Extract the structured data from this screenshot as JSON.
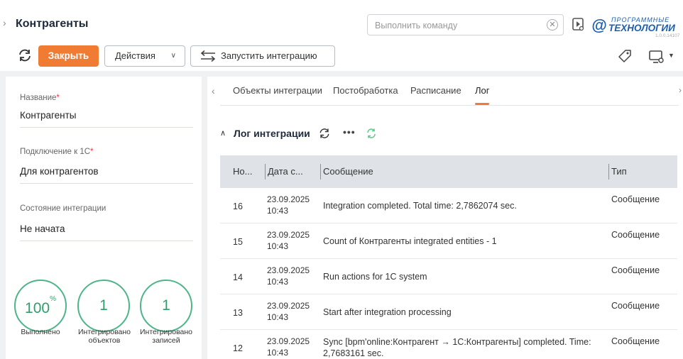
{
  "header": {
    "title": "Контрагенты",
    "command_placeholder": "Выполнить команду",
    "logo_top": "ПРОГРАММНЫЕ",
    "logo_main": "ТЕХНОЛОГИИ",
    "logo_version": "1.0.0.14107"
  },
  "toolbar": {
    "close_label": "Закрыть",
    "actions_label": "Действия",
    "run_integration_label": "Запустить интеграцию"
  },
  "form": {
    "name_label": "Название",
    "name_value": "Контрагенты",
    "connection_label": "Подключение к 1С",
    "connection_value": "Для контрагентов",
    "state_label": "Состояние интеграции",
    "state_value": "Не начата",
    "required_mark": "*"
  },
  "stats": [
    {
      "value": "100",
      "suffix": "%",
      "caption": "Выполнено"
    },
    {
      "value": "1",
      "suffix": "",
      "caption": "Интегрировано объектов"
    },
    {
      "value": "1",
      "suffix": "",
      "caption": "Интегрировано записей"
    }
  ],
  "tabs": [
    {
      "label": "Объекты интеграции",
      "active": false
    },
    {
      "label": "Постобработка",
      "active": false
    },
    {
      "label": "Расписание",
      "active": false
    },
    {
      "label": "Лог",
      "active": true
    }
  ],
  "log": {
    "title": "Лог интеграции",
    "columns": [
      "Но...",
      "Дата с...",
      "Сообщение",
      "Тип"
    ],
    "rows": [
      {
        "no": "16",
        "date": "23.09.2025 10:43",
        "message": "Integration completed. Total time: 2,7862074 sec.",
        "type": "Сообщение"
      },
      {
        "no": "15",
        "date": "23.09.2025 10:43",
        "message": "Count of Контрагенты integrated entities - 1",
        "type": "Сообщение"
      },
      {
        "no": "14",
        "date": "23.09.2025 10:43",
        "message": "Run actions for 1C system",
        "type": "Сообщение"
      },
      {
        "no": "13",
        "date": "23.09.2025 10:43",
        "message": "Start after integration processing",
        "type": "Сообщение"
      },
      {
        "no": "12",
        "date": "23.09.2025 10:43",
        "message": "Sync [bpm'online:Контрагент → 1C:Контрагенты] completed. Time: 2,7683161 sec.",
        "type": "Сообщение"
      }
    ]
  },
  "colors": {
    "accent": "#f07c34",
    "success": "#4db588",
    "brand": "#1a5fb0"
  }
}
